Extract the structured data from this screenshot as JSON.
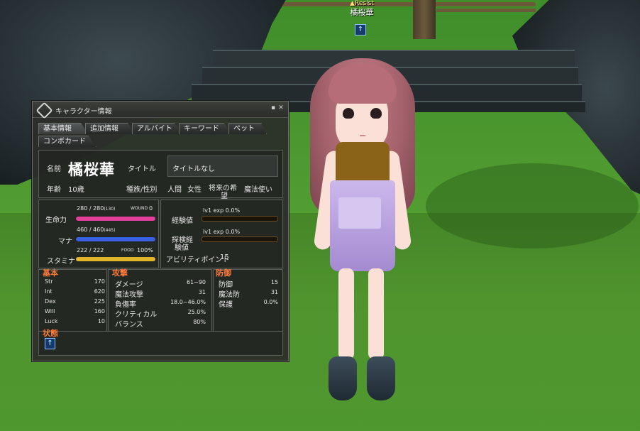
{
  "npc": {
    "resist_label": "Resist",
    "name": "橘桜華",
    "status_icon": "up-arrow-icon"
  },
  "window": {
    "title": "キャラクター情報",
    "minimize_glyph": "▪",
    "close_glyph": "✕",
    "icon": "character-emblem-icon"
  },
  "tabs": [
    {
      "label": "基本情報",
      "active": true
    },
    {
      "label": "追加情報"
    },
    {
      "label": "アルバイト"
    },
    {
      "label": "キーワード"
    },
    {
      "label": "ペット"
    },
    {
      "label": "コンボカード"
    }
  ],
  "profile": {
    "name_label": "名前",
    "name": "橘桜華",
    "title_label": "タイトル",
    "title_value": "タイトルなし",
    "age_label": "年齢",
    "age": "10歳",
    "race_gender_label": "種族/性別",
    "race": "人間",
    "gender": "女性",
    "dream_label_1": "将来の希",
    "dream_label_2": "望",
    "dream": "魔法使い"
  },
  "vitals": {
    "hp_label": "生命力",
    "hp": "280 / 280",
    "hp_max": "(130)",
    "wound_label": "WOUND",
    "wound": "0",
    "hp_ratio": 1.0,
    "mp_label": "マナ",
    "mp": "460 / 460",
    "mp_max": "(445)",
    "mp_ratio": 1.0,
    "sp_label": "スタミナ",
    "sp": "222 / 222",
    "food_label": "FOOD",
    "food": "100%",
    "sp_ratio": 1.0
  },
  "experience": {
    "exp_label": "経験値",
    "exp_level": "lv1 exp 0.0%",
    "exp_ratio": 0.0,
    "explore_label_1": "探検経",
    "explore_label_2": "験値",
    "explore_level": "lv1 exp 0.0%",
    "explore_ratio": 0.0,
    "ap_label": "アビリティポイント",
    "ap": "15"
  },
  "base": {
    "heading": "基本",
    "rows": [
      {
        "label": "Str",
        "value": "170"
      },
      {
        "label": "Int",
        "value": "620"
      },
      {
        "label": "Dex",
        "value": "225"
      },
      {
        "label": "Will",
        "value": "160"
      },
      {
        "label": "Luck",
        "value": "10"
      }
    ]
  },
  "attack": {
    "heading": "攻撃",
    "rows": [
      {
        "label": "ダメージ",
        "value": "61~90"
      },
      {
        "label": "魔法攻撃",
        "value": "31"
      },
      {
        "label": "負傷率",
        "value": "18.0~46.0%"
      },
      {
        "label": "クリティカル",
        "value": "25.0%"
      },
      {
        "label": "バランス",
        "value": "80%"
      }
    ]
  },
  "defense": {
    "heading": "防御",
    "rows": [
      {
        "label": "防御",
        "value": "15"
      },
      {
        "label": "魔法防",
        "value": "31"
      },
      {
        "label": "保護",
        "value": "0.0%"
      }
    ]
  },
  "state": {
    "heading": "状態",
    "icon": "up-arrow-icon"
  },
  "colors": {
    "hp_bar": "#e0409a",
    "mp_bar": "#3a62e0",
    "sp_bar": "#e0b52a",
    "exp_bar": "#6a4a22",
    "section_heading": "#ff7b3a"
  }
}
